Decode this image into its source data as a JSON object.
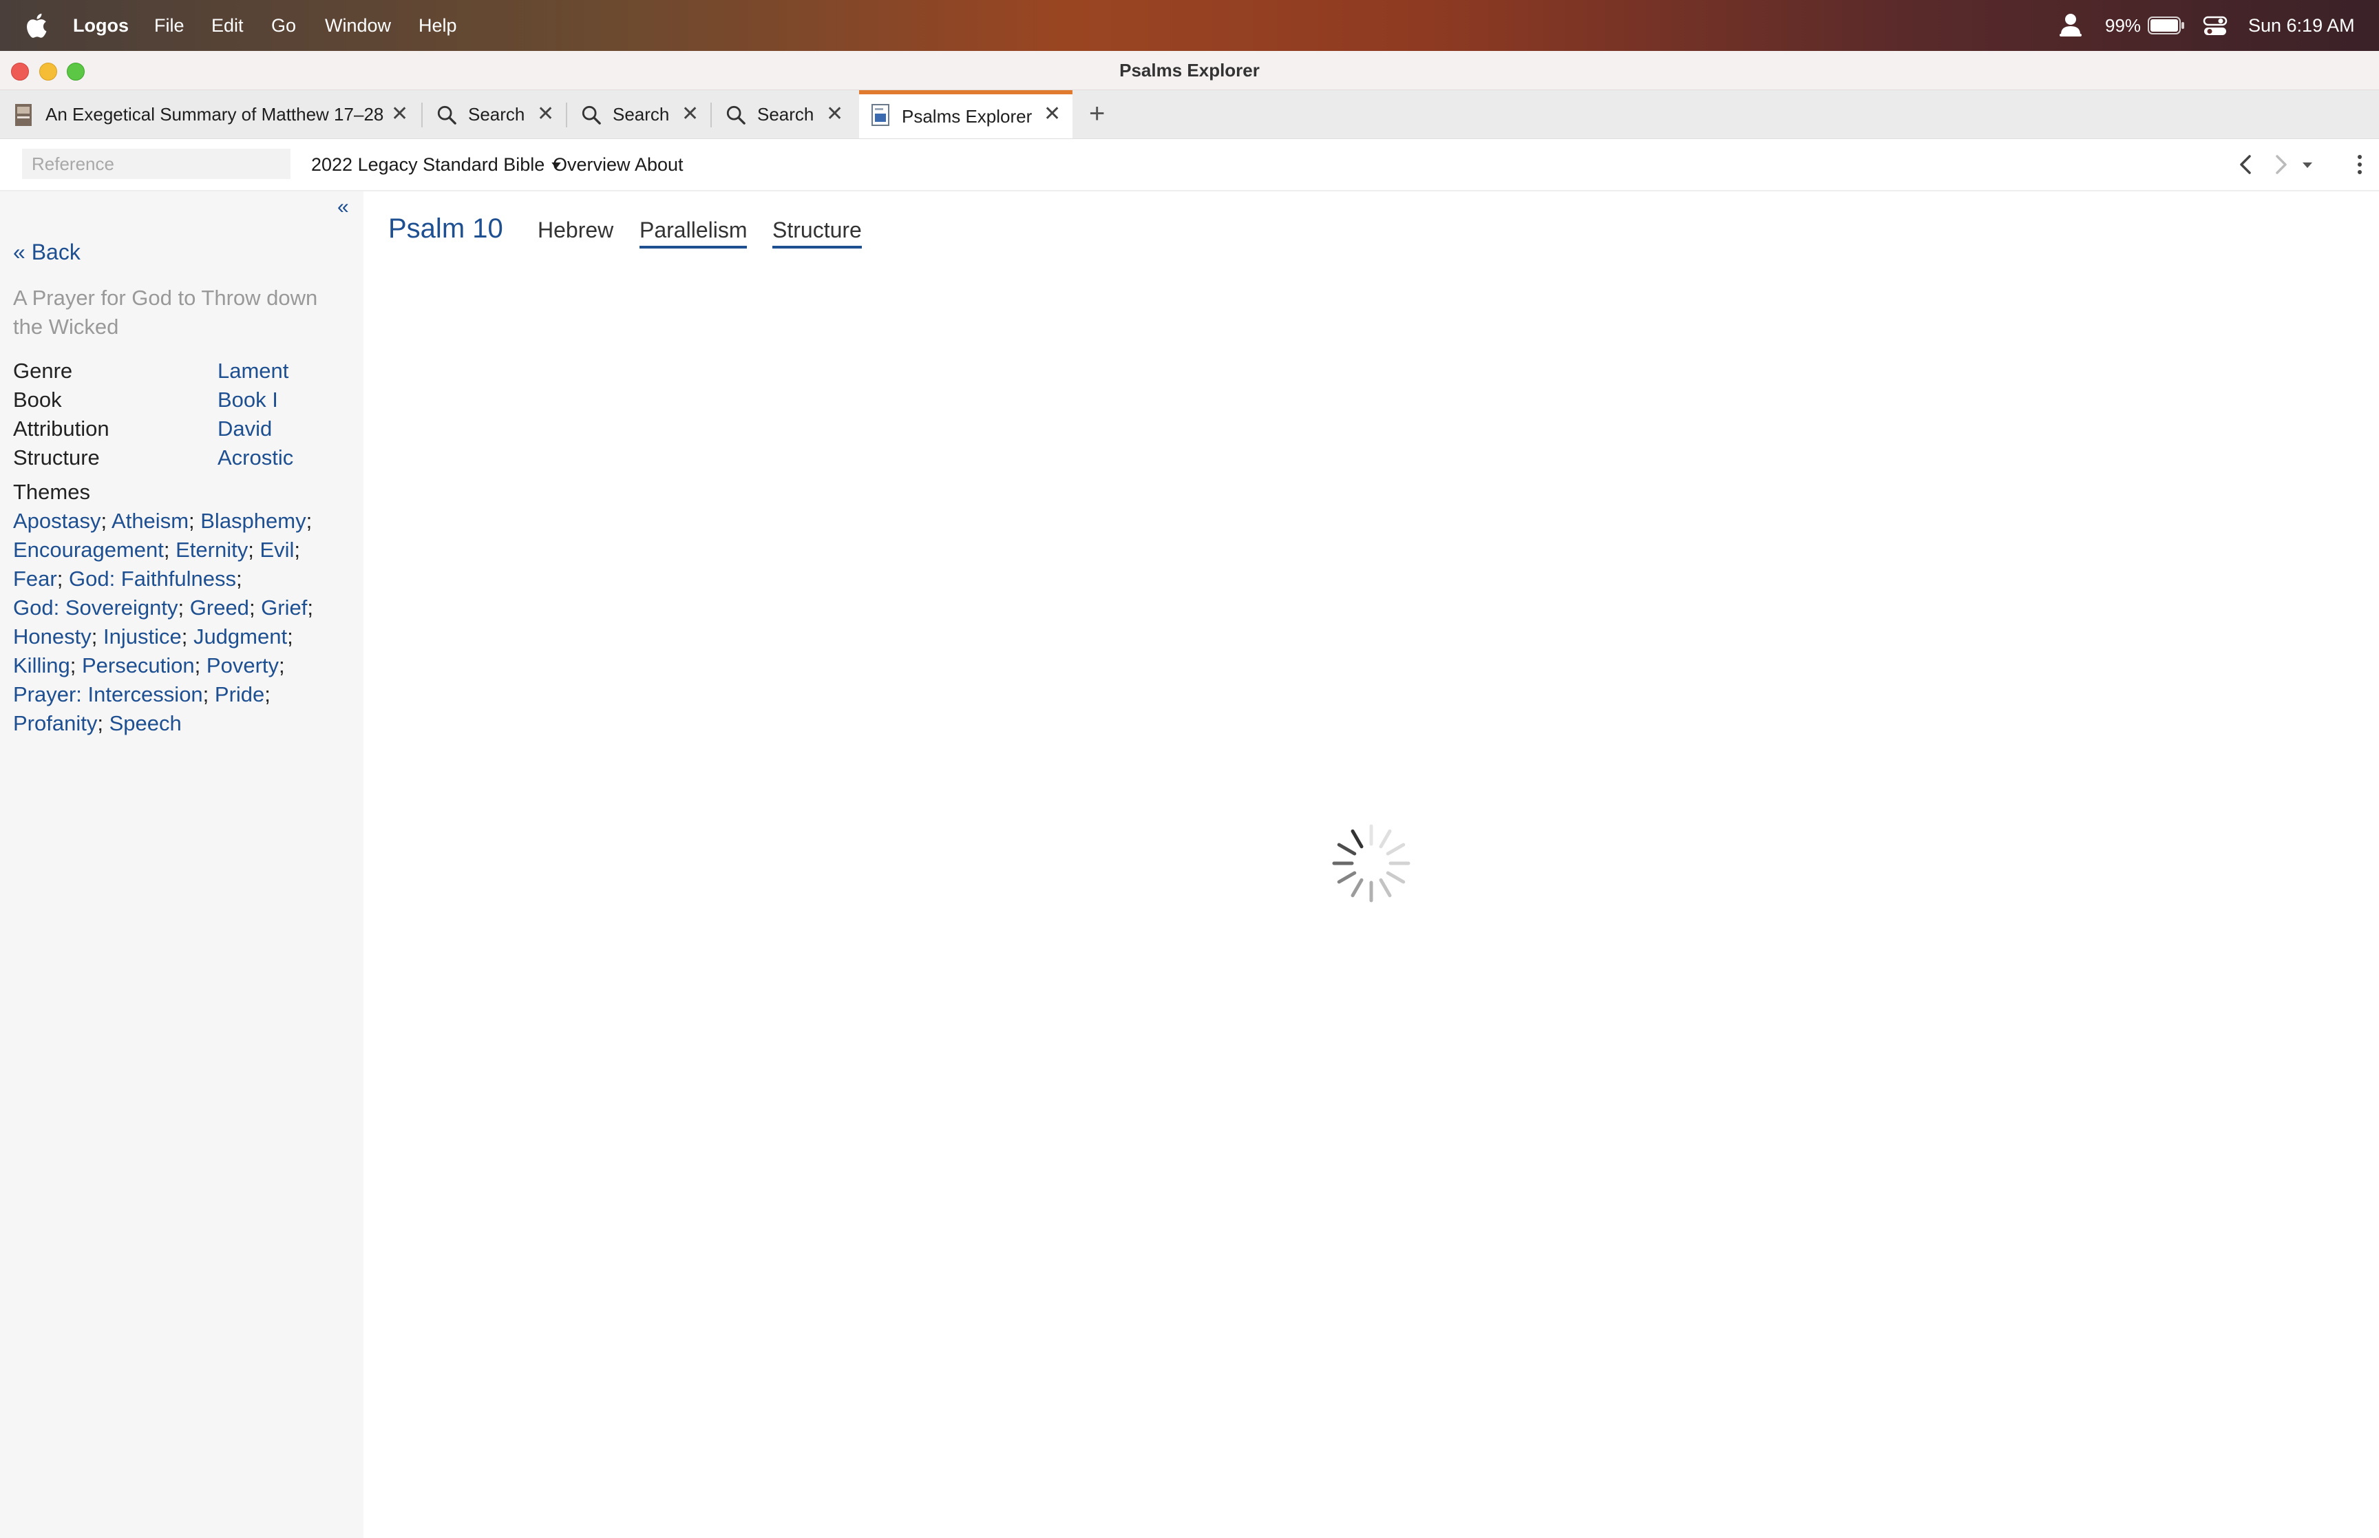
{
  "menubar": {
    "app_name": "Logos",
    "items": [
      "File",
      "Edit",
      "Go",
      "Window",
      "Help"
    ],
    "battery": "99%",
    "clock": "Sun 6:19 AM"
  },
  "window": {
    "title": "Psalms Explorer"
  },
  "tabs": [
    {
      "label": "An Exegetical Summary of Matthew 17–28",
      "icon": "book-cover-icon"
    },
    {
      "label": "Search",
      "icon": "search-icon"
    },
    {
      "label": "Search",
      "icon": "search-icon"
    },
    {
      "label": "Search",
      "icon": "search-icon"
    },
    {
      "label": "Psalms Explorer",
      "icon": "psalms-explorer-icon",
      "active": true
    }
  ],
  "toolbar": {
    "reference_placeholder": "Reference",
    "bible": "2022 Legacy Standard Bible",
    "overview": "Overview",
    "about": "About"
  },
  "sidebar": {
    "collapse": "«",
    "back": "« Back",
    "subtitle": "A Prayer for God to Throw down the Wicked",
    "info": [
      {
        "label": "Genre",
        "value": "Lament"
      },
      {
        "label": "Book",
        "value": "Book I"
      },
      {
        "label": "Attribution",
        "value": "David"
      },
      {
        "label": "Structure",
        "value": "Acrostic"
      }
    ],
    "themes_label": "Themes",
    "theme_lines": [
      [
        "Apostasy",
        "Atheism",
        "Blasphemy"
      ],
      [
        "Encouragement",
        "Eternity",
        "Evil"
      ],
      [
        "Fear",
        "God: Faithfulness"
      ],
      [
        "God: Sovereignty",
        "Greed",
        "Grief"
      ],
      [
        "Honesty",
        "Injustice",
        "Judgment"
      ],
      [
        "Killing",
        "Persecution",
        "Poverty"
      ],
      [
        "Prayer: Intercession",
        "Pride"
      ],
      [
        "Profanity",
        "Speech"
      ]
    ]
  },
  "main": {
    "psalm": "Psalm 10",
    "view_tabs": [
      "Hebrew",
      "Parallelism",
      "Structure"
    ]
  },
  "colors": {
    "link": "#1d4f91",
    "active_tab_accent": "#e07a2e"
  }
}
